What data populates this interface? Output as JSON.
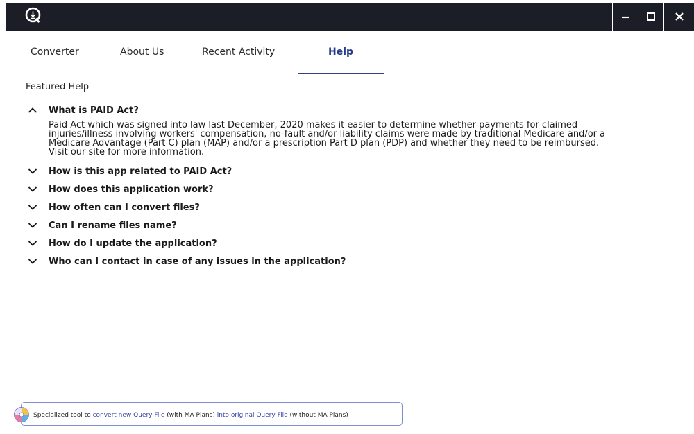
{
  "titlebar": {
    "logo_icon": "q-download-logo-icon",
    "minimize_icon": "minimize-icon",
    "maximize_icon": "maximize-icon",
    "close_icon": "close-icon"
  },
  "tabs": [
    {
      "label": "Converter",
      "active": false
    },
    {
      "label": "About Us",
      "active": false
    },
    {
      "label": "Recent Activity",
      "active": false
    },
    {
      "label": "Help",
      "active": true
    }
  ],
  "featured_help_label": "Featured Help",
  "faq": {
    "open_item": {
      "question": "What is PAID Act?",
      "answer_lines": [
        "Paid Act which was signed into law last December, 2020 makes it easier to determine whether payments for claimed",
        "injuries/illness involving workers' compensation, no-fault and/or liability claims were made by traditional Medicare and/or a",
        "Medicare Advantage (Part C) plan (MAP) and/or a prescription Part D plan (PDP) and whether they need to be reimbursed.",
        "Visit our site for more information."
      ]
    },
    "closed_items": [
      "How is this app related to PAID Act?",
      "How does this application work?",
      "How often can I convert files?",
      "Can I rename files name?",
      "How do I update the application?",
      "Who can I contact in case of any issues in the application?"
    ]
  },
  "banner": {
    "icon": "colorful-disc-icon",
    "prefix": "Specialized tool to ",
    "link1": "convert new Query File",
    "mid1": " (with MA Plans) ",
    "link2": "into original Query File",
    "suffix": " (without MA Plans)"
  },
  "colors": {
    "titlebar_bg": "#1b1e27",
    "accent": "#2e3f8c",
    "link": "#3343a0"
  }
}
